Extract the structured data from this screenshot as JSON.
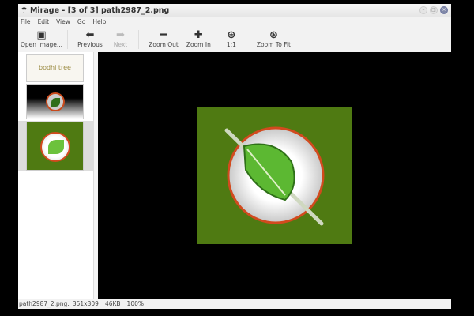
{
  "window": {
    "title": "Mirage - [3 of 3] path2987_2.png"
  },
  "menu": [
    "File",
    "Edit",
    "View",
    "Go",
    "Help"
  ],
  "toolbar": {
    "open": "Open Image...",
    "previous": "Previous",
    "next": "Next",
    "zoom_out": "Zoom Out",
    "zoom_in": "Zoom In",
    "one_to_one": "1:1",
    "zoom_fit": "Zoom To Fit"
  },
  "thumbnails": [
    {
      "label": "bodhi tree"
    },
    {
      "label": ""
    },
    {
      "label": ""
    }
  ],
  "status": {
    "file": "path2987_2.png:",
    "dims": "351x309",
    "size": "46KB",
    "zoom": "100%"
  }
}
